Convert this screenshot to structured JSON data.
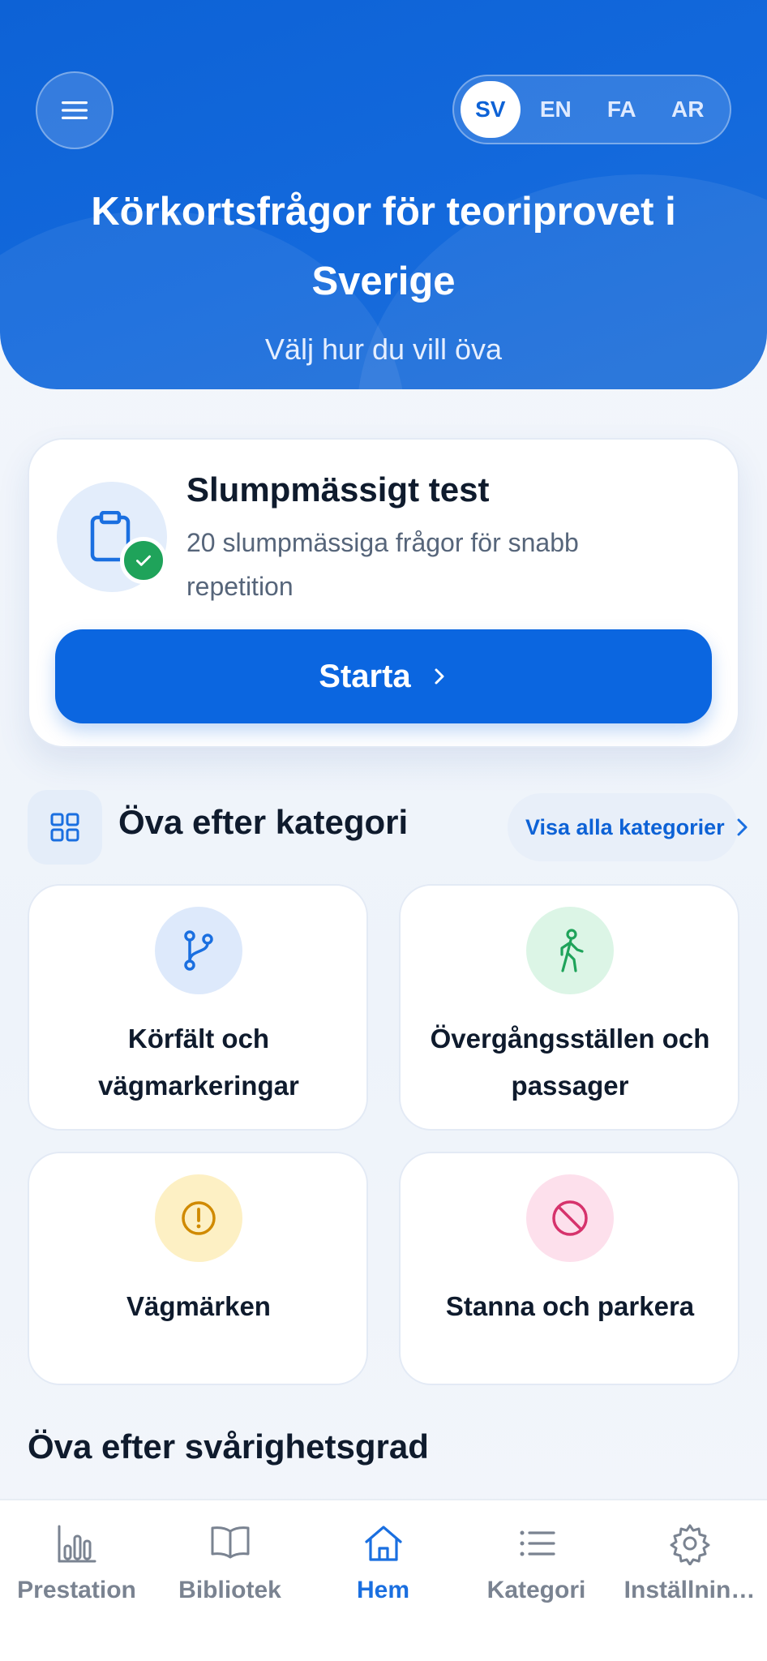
{
  "header": {
    "languages": [
      "SV",
      "EN",
      "FA",
      "AR"
    ],
    "active_language": "SV",
    "title": "Körkortsfrågor för teoriprovet i Sverige",
    "subtitle": "Välj hur du vill öva"
  },
  "random_test": {
    "title": "Slumpmässigt test",
    "description": "20 slumpmässiga frågor för snabb repetition",
    "start_label": "Starta"
  },
  "categories": {
    "section_title": "Öva efter kategori",
    "see_all_label": "Visa alla kategorier",
    "items": [
      {
        "label": "Körfält och vägmarkeringar",
        "icon": "branch-icon",
        "color": "#1a6fe0",
        "bg": "#dde9fb"
      },
      {
        "label": "Övergångsställen och passager",
        "icon": "pedestrian-icon",
        "color": "#1fa35a",
        "bg": "#dcf5e6"
      },
      {
        "label": "Vägmärken",
        "icon": "warning-icon",
        "color": "#d08a00",
        "bg": "#fdf0c4"
      },
      {
        "label": "Stanna och parkera",
        "icon": "no-entry-icon",
        "color": "#d6336c",
        "bg": "#fde0ec"
      }
    ]
  },
  "difficulty": {
    "section_title": "Öva efter svårighetsgrad"
  },
  "bottom_nav": {
    "items": [
      {
        "label": "Prestation",
        "icon": "bar-chart-icon"
      },
      {
        "label": "Bibliotek",
        "icon": "book-icon"
      },
      {
        "label": "Hem",
        "icon": "home-icon"
      },
      {
        "label": "Kategori",
        "icon": "list-icon"
      },
      {
        "label": "Inställnin…",
        "icon": "gear-icon"
      }
    ],
    "active": "Hem"
  },
  "colors": {
    "primary": "#0b66e0",
    "nav_active": "#1a6fe0",
    "nav_inactive": "#7a8391"
  }
}
